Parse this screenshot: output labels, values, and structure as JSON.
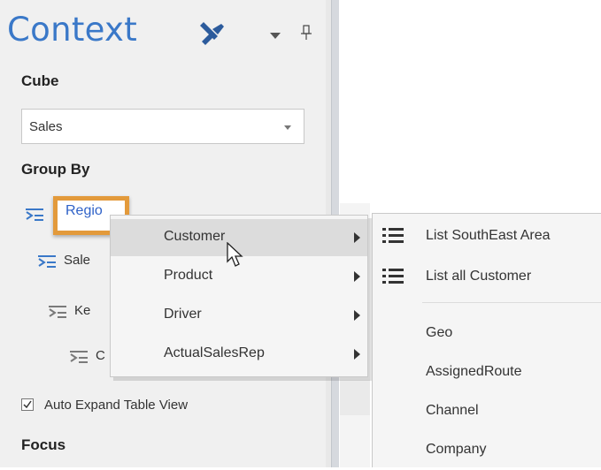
{
  "panel": {
    "title": "Context",
    "cube_label": "Cube",
    "cube_value": "Sales",
    "group_by_label": "Group By",
    "group_items": [
      {
        "label": "Regio"
      },
      {
        "label": "Sale"
      },
      {
        "label": "Ke"
      },
      {
        "label": "C"
      }
    ],
    "auto_expand_label": "Auto Expand Table View",
    "focus_label": "Focus"
  },
  "context_menu": {
    "items": [
      {
        "label": "Customer"
      },
      {
        "label": "Product"
      },
      {
        "label": "Driver"
      },
      {
        "label": "ActualSalesRep"
      }
    ]
  },
  "submenu": {
    "list_items": [
      {
        "label": "List SouthEast Area"
      },
      {
        "label": "List all Customer"
      }
    ],
    "items": [
      {
        "label": "Geo"
      },
      {
        "label": "AssignedRoute"
      },
      {
        "label": "Channel"
      },
      {
        "label": "Company"
      }
    ]
  },
  "colors": {
    "accent": "#3a78c8",
    "highlight_border": "#e39a3b",
    "group_icon": "#3a78c8"
  }
}
